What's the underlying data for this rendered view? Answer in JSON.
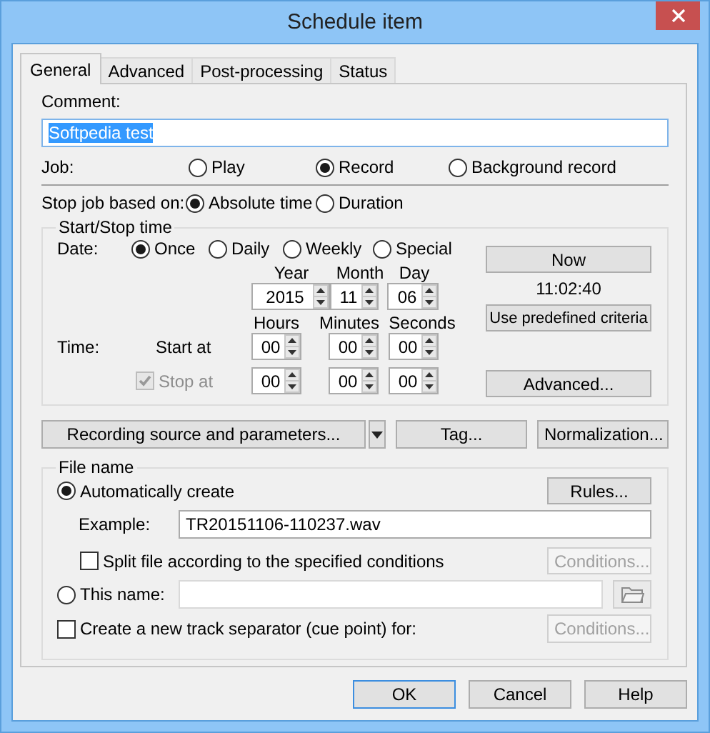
{
  "window": {
    "title": "Schedule item"
  },
  "tabs": [
    {
      "label": "General",
      "selected": true
    },
    {
      "label": "Advanced",
      "selected": false
    },
    {
      "label": "Post-processing",
      "selected": false
    },
    {
      "label": "Status",
      "selected": false
    }
  ],
  "comment": {
    "label": "Comment:",
    "value": "Softpedia test",
    "text_selected": true
  },
  "job": {
    "label": "Job:",
    "options": [
      {
        "label": "Play",
        "selected": false
      },
      {
        "label": "Record",
        "selected": true
      },
      {
        "label": "Background record",
        "selected": false
      }
    ]
  },
  "stop_based_on": {
    "label": "Stop job based on:",
    "options": [
      {
        "label": "Absolute time",
        "selected": true
      },
      {
        "label": "Duration",
        "selected": false
      }
    ]
  },
  "start_stop": {
    "title": "Start/Stop time",
    "date_label": "Date:",
    "date_options": [
      {
        "label": "Once",
        "selected": true
      },
      {
        "label": "Daily",
        "selected": false
      },
      {
        "label": "Weekly",
        "selected": false
      },
      {
        "label": "Special",
        "selected": false
      }
    ],
    "date_fields": [
      {
        "label": "Year",
        "value": "2015"
      },
      {
        "label": "Month",
        "value": "11"
      },
      {
        "label": "Day",
        "value": "06"
      }
    ],
    "time_label": "Time:",
    "time_headers": [
      "Hours",
      "Minutes",
      "Seconds"
    ],
    "start": {
      "label": "Start at",
      "values": [
        "00",
        "00",
        "00"
      ]
    },
    "stop": {
      "label": "Stop at",
      "checked": true,
      "disabled": true,
      "values": [
        "00",
        "00",
        "00"
      ]
    },
    "now_button": "Now",
    "clock": "11:02:40",
    "predefined_button": "Use predefined criteria",
    "advanced_button": "Advanced..."
  },
  "action_buttons": [
    {
      "label": "Recording source and parameters...",
      "kind": "split"
    },
    {
      "label": "Tag...",
      "kind": "plain"
    },
    {
      "label": "Normalization...",
      "kind": "plain"
    }
  ],
  "file_name": {
    "title": "File name",
    "auto": {
      "label": "Automatically create",
      "selected": true
    },
    "rules_button": "Rules...",
    "example_label": "Example:",
    "example_value": "TR20151106-110237.wav",
    "split": {
      "label": "Split file according to the specified conditions",
      "checked": false
    },
    "split_conditions": {
      "label": "Conditions...",
      "disabled": true
    },
    "this_name": {
      "label": "This name:",
      "selected": false
    },
    "separator": {
      "label": "Create a new track separator (cue point) for:",
      "checked": false
    },
    "separator_conditions": {
      "label": "Conditions...",
      "disabled": true
    }
  },
  "dialog_buttons": [
    {
      "label": "OK",
      "focused": true
    },
    {
      "label": "Cancel",
      "focused": false
    },
    {
      "label": "Help",
      "focused": false
    }
  ]
}
